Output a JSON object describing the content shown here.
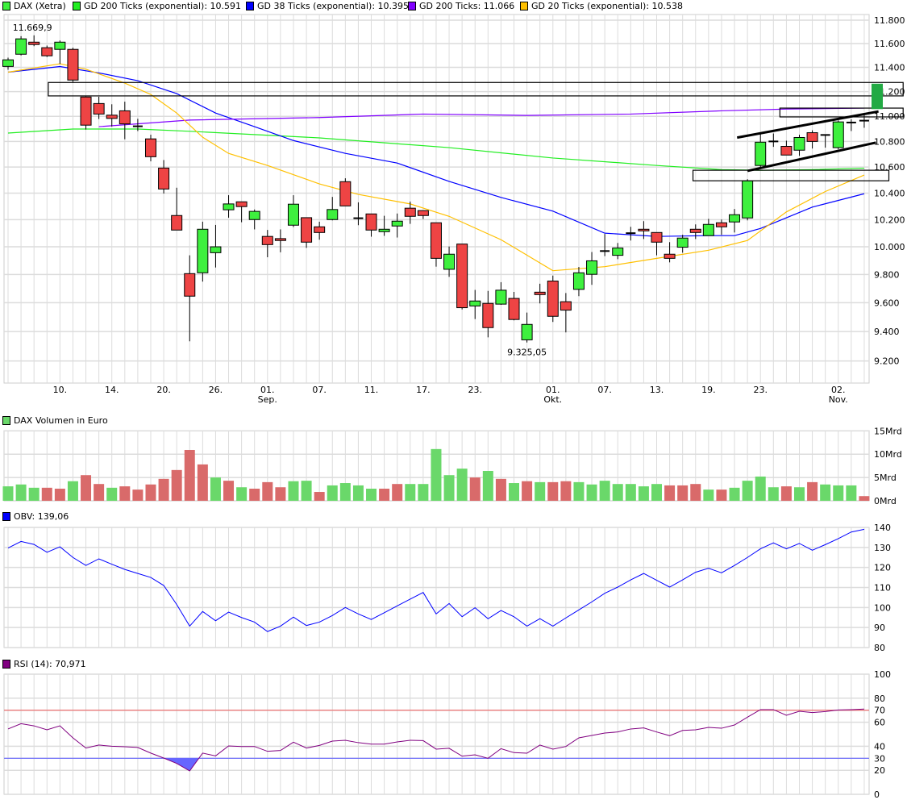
{
  "legend": [
    {
      "label": "DAX (Xetra)",
      "color": "#3ef03e"
    },
    {
      "label": "GD 200 Ticks (exponential): 10.591",
      "color": "#22ee22"
    },
    {
      "label": "GD 38 Ticks (exponential): 10.395",
      "color": "#0000ff"
    },
    {
      "label": "GD 200 Ticks: 11.066",
      "color": "#8000ff"
    },
    {
      "label": "GD 20 Ticks (exponential): 10.538",
      "color": "#ffc000"
    }
  ],
  "panels": {
    "volume_label": "DAX Volumen in Euro",
    "obv_label": "OBV: 139,06",
    "rsi_label": "RSI (14): 70,971"
  },
  "colors": {
    "up": "#3ef03e",
    "down": "#ee4444",
    "vol_up": "#6ad86a",
    "vol_down": "#d96a6a",
    "grid": "#dcdcdc"
  },
  "chart_data": [
    {
      "type": "candlestick",
      "title": "DAX (Xetra)",
      "scale": "log",
      "ylim": [
        9100,
        11850
      ],
      "yticks": [
        11800,
        11600,
        11400,
        11200,
        11000,
        10800,
        10600,
        10400,
        10200,
        10000,
        9800,
        9600,
        9400,
        9200
      ],
      "ytick_labels": [
        "11.800",
        "11.600",
        "11.400",
        "11.200",
        "11.000",
        "10.800",
        "10.600",
        "10.400",
        "10.200",
        "10.000",
        "9.800",
        "9.600",
        "9.400",
        "9.200"
      ],
      "xticks": [
        {
          "index": 4,
          "label": "10."
        },
        {
          "index": 8,
          "label": "14."
        },
        {
          "index": 12,
          "label": "20."
        },
        {
          "index": 16,
          "label": "26."
        },
        {
          "index": 20,
          "label": "01.",
          "month": "Sep."
        },
        {
          "index": 24,
          "label": "07."
        },
        {
          "index": 28,
          "label": "11."
        },
        {
          "index": 32,
          "label": "17."
        },
        {
          "index": 36,
          "label": "23."
        },
        {
          "index": 42,
          "label": "01.",
          "month": "Okt."
        },
        {
          "index": 46,
          "label": "07."
        },
        {
          "index": 50,
          "label": "13."
        },
        {
          "index": 54,
          "label": "19."
        },
        {
          "index": 58,
          "label": "23."
        },
        {
          "index": 64,
          "label": "02.",
          "month": "Nov."
        }
      ],
      "ohlc": [
        [
          11408,
          11481,
          11380,
          11463
        ],
        [
          11510,
          11663,
          11500,
          11640
        ],
        [
          11612,
          11670,
          11578,
          11592
        ],
        [
          11565,
          11583,
          11487,
          11497
        ],
        [
          11551,
          11626,
          11429,
          11612
        ],
        [
          11551,
          11565,
          11279,
          11295
        ],
        [
          11156,
          11160,
          10894,
          10929
        ],
        [
          11103,
          11158,
          10978,
          11018
        ],
        [
          11009,
          11097,
          10918,
          10983
        ],
        [
          11044,
          11118,
          10817,
          10939
        ],
        [
          10920,
          10980,
          10882,
          10916
        ],
        [
          10820,
          10853,
          10644,
          10680
        ],
        [
          10592,
          10654,
          10397,
          10431
        ],
        [
          10231,
          10441,
          10123,
          10123
        ],
        [
          9806,
          9938,
          9333,
          9646
        ],
        [
          9812,
          10185,
          9749,
          10129
        ],
        [
          9957,
          10161,
          9850,
          10000
        ],
        [
          10274,
          10384,
          10215,
          10318
        ],
        [
          10334,
          10334,
          10181,
          10298
        ],
        [
          10201,
          10276,
          10128,
          10262
        ],
        [
          10076,
          10124,
          9924,
          10016
        ],
        [
          10060,
          10128,
          9960,
          10046
        ],
        [
          10159,
          10384,
          10145,
          10316
        ],
        [
          10215,
          10215,
          9992,
          10034
        ],
        [
          10147,
          10185,
          10052,
          10105
        ],
        [
          10201,
          10371,
          10195,
          10276
        ],
        [
          10487,
          10513,
          10303,
          10303
        ],
        [
          10211,
          10330,
          10159,
          10211
        ],
        [
          10243,
          10243,
          10074,
          10123
        ],
        [
          10111,
          10229,
          10080,
          10129
        ],
        [
          10153,
          10246,
          10068,
          10189
        ],
        [
          10286,
          10336,
          10169,
          10225
        ],
        [
          10268,
          10268,
          10205,
          10231
        ],
        [
          10177,
          10177,
          9856,
          9916
        ],
        [
          9837,
          10002,
          9783,
          9946
        ],
        [
          10020,
          10020,
          9553,
          9565
        ],
        [
          9577,
          9690,
          9486,
          9612
        ],
        [
          9595,
          9683,
          9360,
          9427
        ],
        [
          9590,
          9745,
          9585,
          9688
        ],
        [
          9630,
          9676,
          9477,
          9483
        ],
        [
          9343,
          9531,
          9325,
          9449
        ],
        [
          9674,
          9734,
          9595,
          9657
        ],
        [
          9753,
          9792,
          9466,
          9505
        ],
        [
          9607,
          9668,
          9394,
          9548
        ],
        [
          9694,
          9854,
          9646,
          9812
        ],
        [
          9801,
          9962,
          9726,
          9898
        ],
        [
          9965,
          10094,
          9932,
          9969
        ],
        [
          9938,
          10028,
          9910,
          9991
        ],
        [
          10095,
          10147,
          10046,
          10100
        ],
        [
          10129,
          10189,
          10057,
          10117
        ],
        [
          10105,
          10105,
          9938,
          10034
        ],
        [
          9946,
          10034,
          9887,
          9916
        ],
        [
          9997,
          10088,
          9957,
          10064
        ],
        [
          10129,
          10165,
          10057,
          10105
        ],
        [
          10082,
          10206,
          10082,
          10165
        ],
        [
          10177,
          10201,
          10088,
          10147
        ],
        [
          10183,
          10280,
          10105,
          10237
        ],
        [
          10213,
          10506,
          10195,
          10493
        ],
        [
          10612,
          10857,
          10592,
          10794
        ],
        [
          10798,
          10863,
          10757,
          10800
        ],
        [
          10761,
          10806,
          10693,
          10693
        ],
        [
          10731,
          10853,
          10687,
          10831
        ],
        [
          10869,
          10888,
          10744,
          10800
        ],
        [
          10849,
          10851,
          10751,
          10851
        ],
        [
          10751,
          10967,
          10738,
          10955
        ],
        [
          10948,
          10976,
          10882,
          10950
        ],
        [
          10962,
          11015,
          10908,
          10965
        ]
      ],
      "high_label": "11.669,9",
      "high_label_index": 2,
      "high_label_value": 11670,
      "low_label": "9.325,05",
      "low_label_index": 40,
      "low_label_value": 9325,
      "series": [
        {
          "name": "GD 200 Ticks (exponential)",
          "color": "#22ee22",
          "points": [
            [
              0,
              10866
            ],
            [
              5,
              10898
            ],
            [
              10,
              10898
            ],
            [
              14,
              10880
            ],
            [
              24,
              10828
            ],
            [
              34,
              10751
            ],
            [
              42,
              10670
            ],
            [
              50,
              10612
            ],
            [
              55,
              10580
            ],
            [
              58,
              10575
            ],
            [
              62,
              10580
            ],
            [
              66,
              10591
            ]
          ]
        },
        {
          "name": "GD 38 Ticks (exponential)",
          "color": "#0000ff",
          "points": [
            [
              0,
              11360
            ],
            [
              4,
              11407
            ],
            [
              7,
              11354
            ],
            [
              10,
              11290
            ],
            [
              13,
              11184
            ],
            [
              16,
              11026
            ],
            [
              19,
              10917
            ],
            [
              22,
              10807
            ],
            [
              26,
              10706
            ],
            [
              30,
              10631
            ],
            [
              34,
              10489
            ],
            [
              38,
              10367
            ],
            [
              42,
              10264
            ],
            [
              46,
              10100
            ],
            [
              50,
              10076
            ],
            [
              54,
              10082
            ],
            [
              56,
              10082
            ],
            [
              58,
              10135
            ],
            [
              62,
              10294
            ],
            [
              66,
              10395
            ]
          ]
        },
        {
          "name": "GD 200 Ticks",
          "color": "#8000ff",
          "points": [
            [
              7,
              10917
            ],
            [
              14,
              10970
            ],
            [
              24,
              10990
            ],
            [
              32,
              11018
            ],
            [
              40,
              11007
            ],
            [
              48,
              11018
            ],
            [
              55,
              11044
            ],
            [
              60,
              11058
            ],
            [
              66,
              11066
            ]
          ]
        },
        {
          "name": "GD 20 Ticks (exponential)",
          "color": "#ffc000",
          "points": [
            [
              0,
              11360
            ],
            [
              4,
              11430
            ],
            [
              6,
              11385
            ],
            [
              9,
              11270
            ],
            [
              11,
              11177
            ],
            [
              13,
              11026
            ],
            [
              15,
              10833
            ],
            [
              17,
              10706
            ],
            [
              20,
              10612
            ],
            [
              24,
              10470
            ],
            [
              27,
              10390
            ],
            [
              31,
              10318
            ],
            [
              34,
              10225
            ],
            [
              38,
              10052
            ],
            [
              42,
              9827
            ],
            [
              46,
              9856
            ],
            [
              50,
              9916
            ],
            [
              54,
              9975
            ],
            [
              57,
              10046
            ],
            [
              60,
              10258
            ],
            [
              63,
              10412
            ],
            [
              66,
              10538
            ]
          ]
        }
      ],
      "annotations": {
        "boxes": [
          {
            "from_index": 3.1,
            "to_index": 69,
            "top": 11275,
            "bottom": 11165
          },
          {
            "from_index": 59.5,
            "to_index": 69,
            "top": 11066,
            "bottom": 10995
          },
          {
            "from_index": 52.8,
            "to_index": 67.9,
            "top": 10575,
            "bottom": 10494
          }
        ],
        "trendlines": [
          {
            "from": [
              56.2,
              10830
            ],
            "to": [
              67.1,
              11039
            ]
          },
          {
            "from": [
              57.0,
              10570
            ],
            "to": [
              66.9,
              10791
            ]
          }
        ],
        "price_marker": {
          "top": 11265,
          "bottom": 11058,
          "color": "#22aa44"
        }
      }
    },
    {
      "type": "bar",
      "title": "DAX Volumen in Euro",
      "unit": "Mrd",
      "ylim": [
        0,
        15
      ],
      "yticks": [
        15,
        10,
        5,
        0
      ],
      "ytick_labels": [
        "15Mrd",
        "10Mrd",
        "5Mrd",
        "0Mrd"
      ],
      "values": [
        3.1,
        3.5,
        2.8,
        2.8,
        2.6,
        4.2,
        5.5,
        3.6,
        2.8,
        3.1,
        2.4,
        3.5,
        4.7,
        6.6,
        10.9,
        7.8,
        5.0,
        4.3,
        2.9,
        2.6,
        4.0,
        2.9,
        4.2,
        4.3,
        1.9,
        3.3,
        3.8,
        3.3,
        2.6,
        2.6,
        3.6,
        3.6,
        3.6,
        11.1,
        5.5,
        6.9,
        5.0,
        6.4,
        4.7,
        3.8,
        4.2,
        4.0,
        4.0,
        4.2,
        4.0,
        3.5,
        4.3,
        3.6,
        3.6,
        3.1,
        3.6,
        3.3,
        3.3,
        3.6,
        2.4,
        2.4,
        2.8,
        4.3,
        5.2,
        2.9,
        3.1,
        2.9,
        4.0,
        3.5,
        3.3,
        3.3,
        1.0
      ],
      "direction": "gggrrgrrgrrrrrrrgrgrrrggrggggrrgggggrgrgrgrrgggggggrrrgrggggrgrggg"
    },
    {
      "type": "line",
      "title": "OBV: 139,06",
      "ylim": [
        80,
        140
      ],
      "yticks": [
        140,
        130,
        120,
        110,
        100,
        90,
        80
      ],
      "ytick_labels": [
        "140",
        "130",
        "120",
        "110",
        "100",
        "90",
        "80"
      ],
      "color": "#0000ff",
      "values": [
        129.7,
        133,
        131.5,
        127.6,
        130.3,
        125,
        121,
        124.3,
        121.6,
        119,
        117,
        115,
        111,
        101.5,
        90.7,
        98,
        93.4,
        97.7,
        95,
        92.7,
        88,
        90.7,
        95.2,
        91,
        92.7,
        96,
        100,
        96.8,
        94,
        97.4,
        100.8,
        104.2,
        107.5,
        96.8,
        102,
        95.4,
        99.9,
        94.4,
        98.5,
        95.4,
        90.7,
        94.4,
        90.7,
        94.8,
        98.8,
        102.8,
        107.1,
        110.2,
        113.8,
        117,
        113.6,
        110.2,
        113.8,
        117.6,
        119.6,
        117.3,
        121,
        125,
        129.3,
        132.3,
        129.3,
        132,
        128.6,
        131.4,
        134.4,
        137.7,
        139.06
      ]
    },
    {
      "type": "line",
      "title": "RSI (14): 70,971",
      "ylim": [
        0,
        100
      ],
      "yticks": [
        100,
        80,
        70,
        60,
        40,
        30,
        20,
        0
      ],
      "ytick_labels": [
        "100",
        "80",
        "70",
        "60",
        "40",
        "30",
        "20",
        "0"
      ],
      "overbought": 70,
      "oversold": 30,
      "color": "#800080",
      "values": [
        54.4,
        58.8,
        57,
        53.7,
        57,
        47,
        38.5,
        41,
        40,
        39.6,
        39,
        34.3,
        30.2,
        25.7,
        19.5,
        34.3,
        32,
        40.3,
        39.8,
        39.8,
        35.8,
        36.5,
        43.4,
        38.5,
        40.7,
        44.3,
        45,
        43,
        41.8,
        41.8,
        43.6,
        45,
        44.7,
        37.6,
        38.3,
        31.8,
        32.9,
        30,
        38,
        34.7,
        34.2,
        41,
        37.6,
        39.8,
        47,
        49,
        51,
        51.9,
        54.4,
        55.3,
        51.9,
        48.8,
        53.2,
        53.7,
        55.7,
        55,
        57.7,
        64.2,
        70.5,
        70.5,
        65.8,
        69.1,
        68,
        68.9,
        70.2,
        70.5,
        70.97
      ]
    }
  ]
}
